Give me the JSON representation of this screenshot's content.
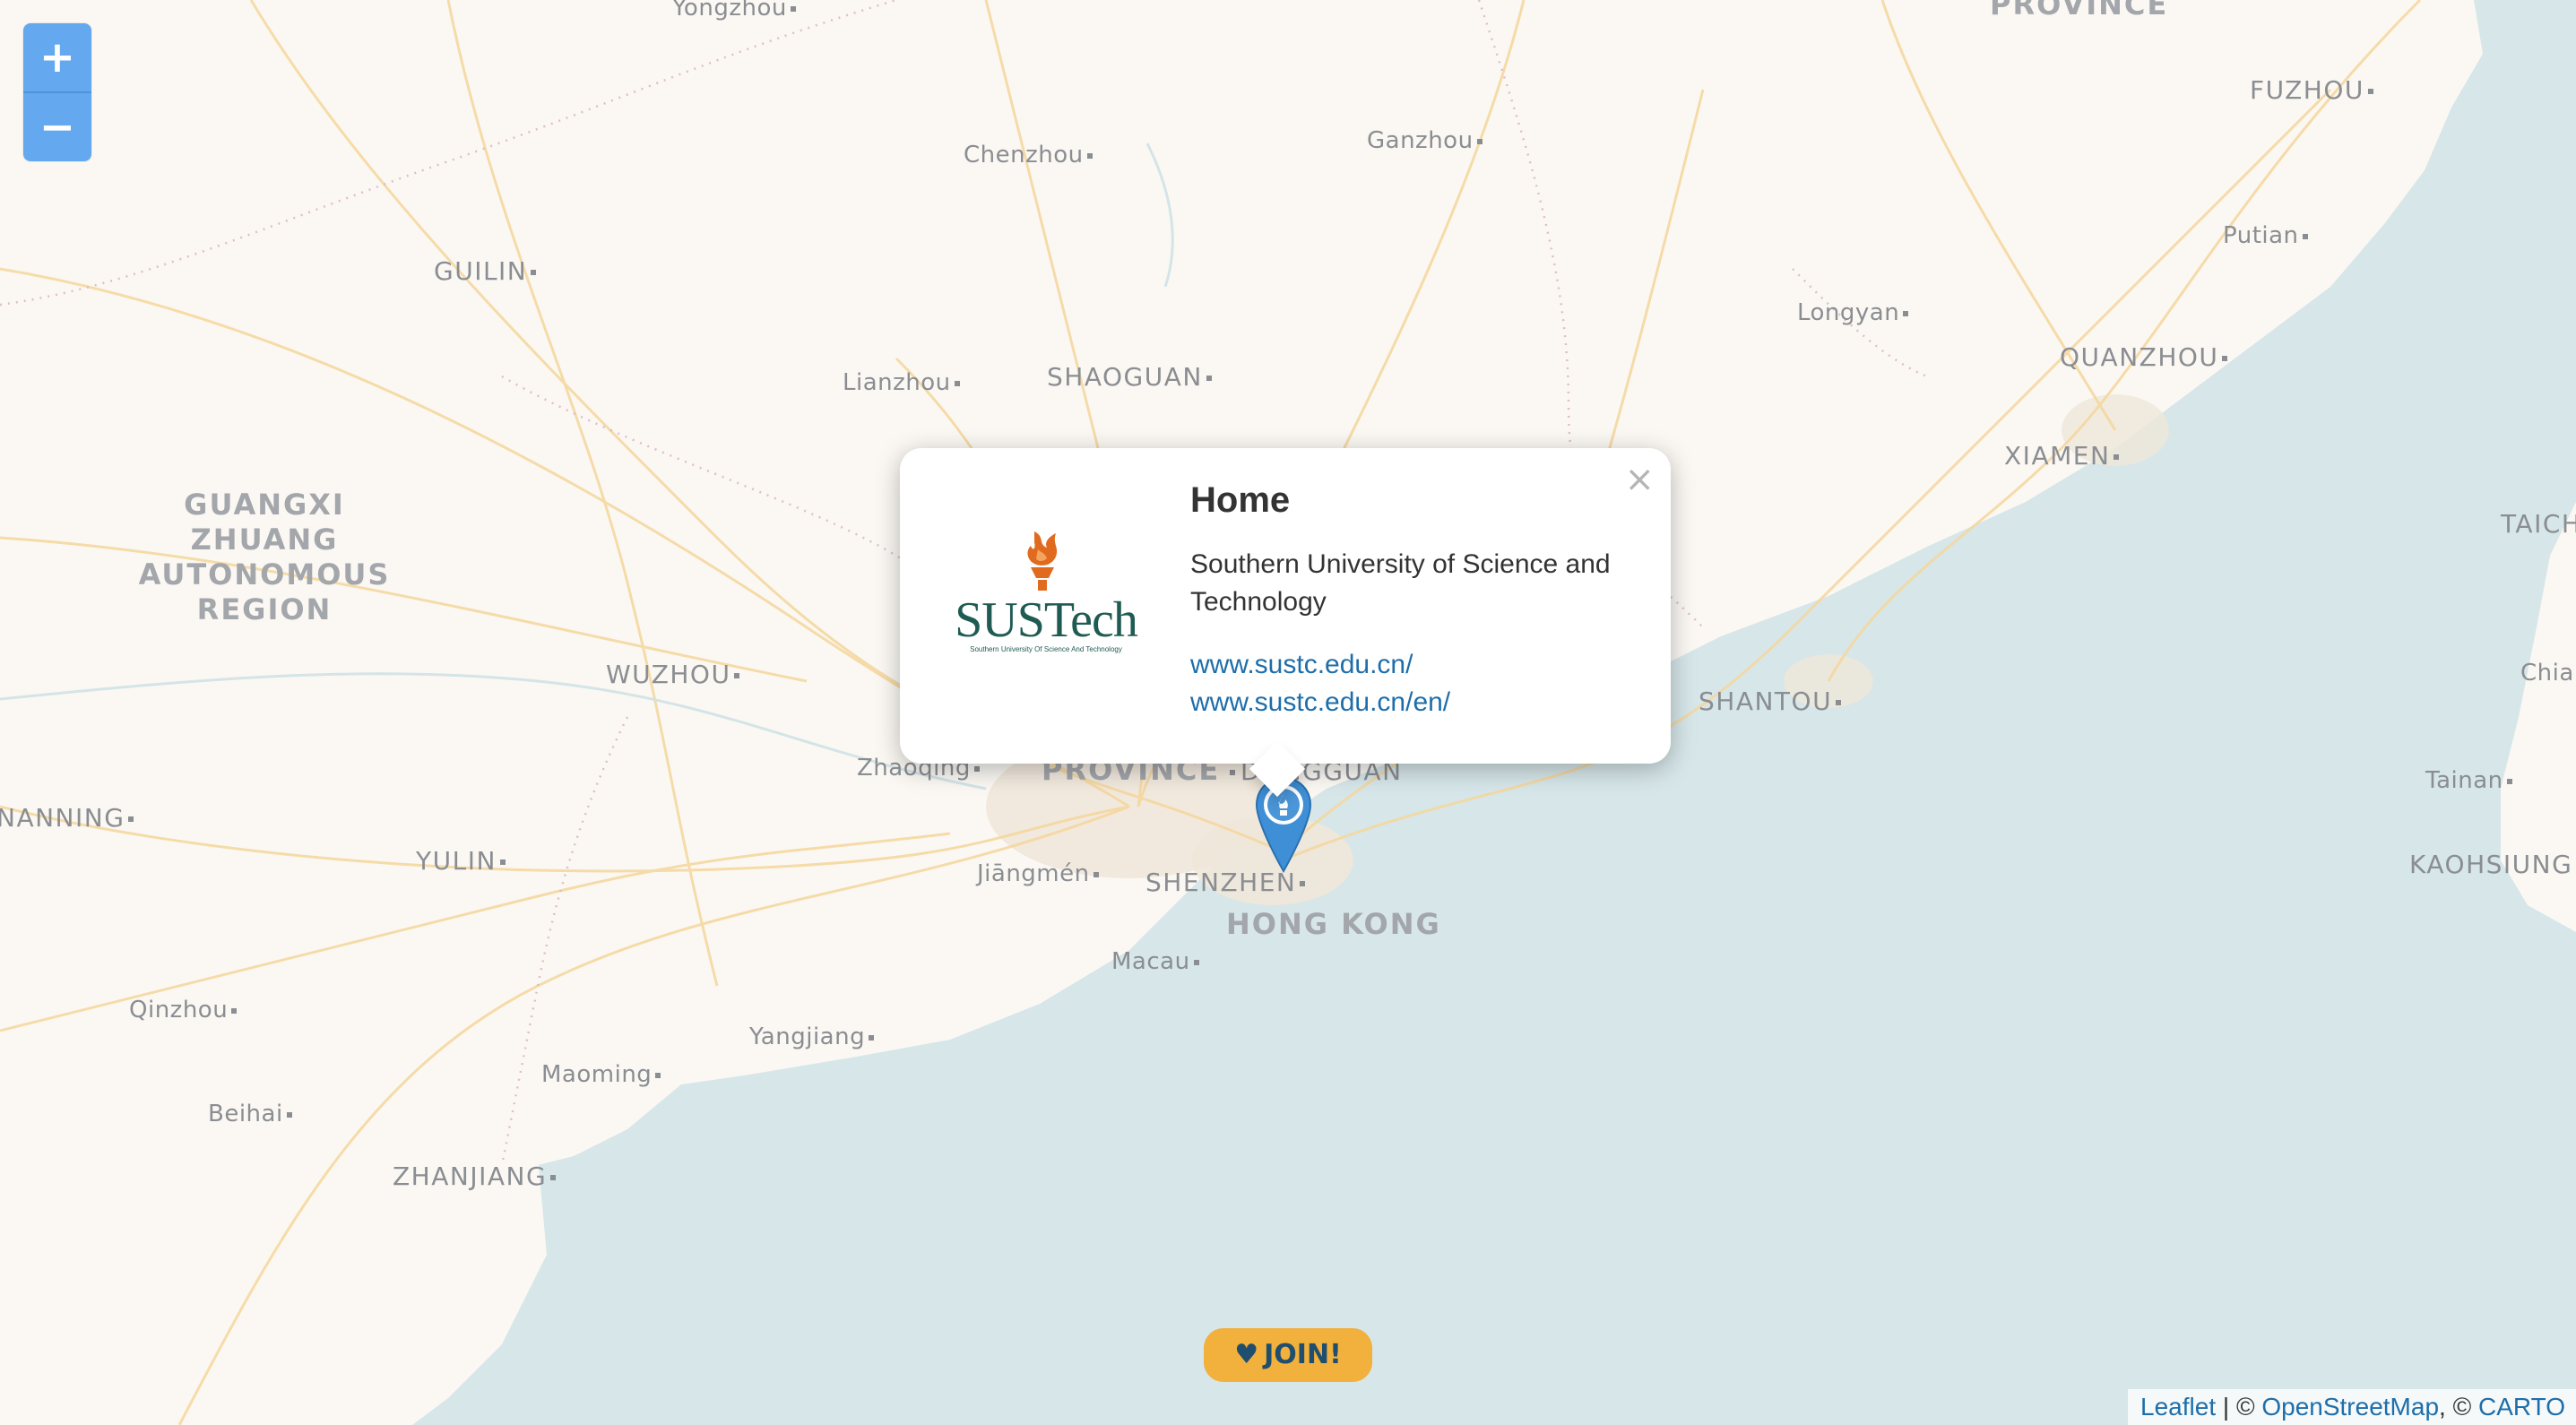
{
  "map": {
    "colors": {
      "sea": "#d6e6e9",
      "land": "#fbf8f3",
      "road": "#f5d8a0",
      "urban": "#efe7da",
      "label": "#8a8d92"
    },
    "places": [
      {
        "id": "yongzhou",
        "label": "Yongzhou"
      },
      {
        "id": "province-top",
        "label": "PROVINCE"
      },
      {
        "id": "fuzhou",
        "label": "FUZHOU"
      },
      {
        "id": "chenzhou",
        "label": "Chenzhou"
      },
      {
        "id": "ganzhou",
        "label": "Ganzhou"
      },
      {
        "id": "putian",
        "label": "Putian"
      },
      {
        "id": "guilin",
        "label": "GUILIN"
      },
      {
        "id": "longyan",
        "label": "Longyan"
      },
      {
        "id": "quanzhou",
        "label": "QUANZHOU"
      },
      {
        "id": "lianzhou",
        "label": "Lianzhou"
      },
      {
        "id": "shaoguan",
        "label": "SHAOGUAN"
      },
      {
        "id": "xiamen",
        "label": "XIAMEN"
      },
      {
        "id": "taichung",
        "label": "TAICH"
      },
      {
        "id": "guangxi",
        "label": "GUANGXI ZHUANG AUTONOMOUS REGION"
      },
      {
        "id": "wuzhou",
        "label": "WUZHOU"
      },
      {
        "id": "shantou",
        "label": "SHANTOU"
      },
      {
        "id": "chiayi",
        "label": "Chia"
      },
      {
        "id": "zhaoqing",
        "label": "Zhaoqing"
      },
      {
        "id": "province-gd",
        "label": "PROVINCE"
      },
      {
        "id": "dongguan",
        "label": "DONGGUAN"
      },
      {
        "id": "tainan",
        "label": "Tainan"
      },
      {
        "id": "nanning",
        "label": "NANNING"
      },
      {
        "id": "yulin",
        "label": "YULIN"
      },
      {
        "id": "jiangmen",
        "label": "Jiāngmén"
      },
      {
        "id": "shenzhen",
        "label": "SHENZHEN"
      },
      {
        "id": "kaohsiung",
        "label": "KAOHSIUNG"
      },
      {
        "id": "hongkong",
        "label": "HONG KONG"
      },
      {
        "id": "macau",
        "label": "Macau"
      },
      {
        "id": "qinzhou",
        "label": "Qinzhou"
      },
      {
        "id": "yangjiang",
        "label": "Yangjiang"
      },
      {
        "id": "maoming",
        "label": "Maoming"
      },
      {
        "id": "beihai",
        "label": "Beihai"
      },
      {
        "id": "zhanjiang",
        "label": "ZHANJIANG"
      }
    ]
  },
  "zoom": {
    "in_label": "+",
    "out_label": "−"
  },
  "marker": {
    "icon": "map-pin-icon",
    "color": "#3e8fd6"
  },
  "popup": {
    "close_label": "×",
    "title": "Home",
    "description": "Southern University of Science and Technology",
    "links": [
      "www.sustc.edu.cn/",
      "www.sustc.edu.cn/en/"
    ],
    "logo": {
      "text": "SUSTech",
      "subtitle": "Southern University Of Science And Technology",
      "text_color": "#1f5b52",
      "flame_color": "#e06a1e"
    }
  },
  "join": {
    "icon": "heart-icon",
    "heart": "♥",
    "label": "JOIN!"
  },
  "attribution": {
    "leaflet": "Leaflet",
    "sep1": " | © ",
    "osm": "OpenStreetMap",
    "sep2": ", © ",
    "carto": "CARTO"
  }
}
